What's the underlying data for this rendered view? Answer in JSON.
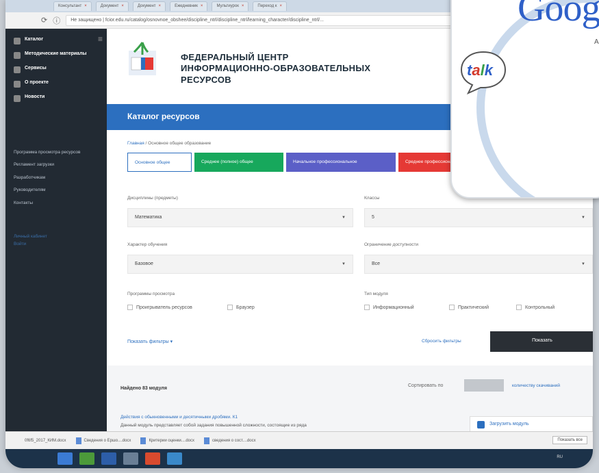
{
  "browser": {
    "tabs": [
      "Консультант",
      "Документ",
      "Документ",
      "Ежедневник",
      "Мультиурок",
      "Переход к"
    ],
    "tab_close": "×",
    "url": "Не защищено | fcior.edu.ru/catalog/osnovnoe_obshee/discipline_ntrl/discipline_ntrl/learning_character/discipline_ntrl/..."
  },
  "sidebar": {
    "items": [
      {
        "label": "Каталог",
        "icon": "catalog-icon"
      },
      {
        "label": "Методические материалы",
        "icon": "book-icon"
      },
      {
        "label": "Сервисы",
        "icon": "gear-icon"
      },
      {
        "label": "О проекте",
        "icon": "info-icon"
      },
      {
        "label": "Новости",
        "icon": "news-icon"
      }
    ],
    "subitems": [
      "Программа просмотра ресурсов",
      "Регламент загрузки",
      "Разработчикам",
      "Руководителям",
      "Контакты"
    ],
    "login": [
      "Личный кабинет",
      "Войти"
    ]
  },
  "header": {
    "org_name_line1": "ФЕДЕРАЛЬНЫЙ ЦЕНТР",
    "org_name_line2": "ИНФОРМАЦИОННО-ОБРАЗОВАТЕЛЬНЫХ",
    "org_name_line3": "РЕСУРСОВ"
  },
  "catalog": {
    "title": "Каталог ресурсов",
    "breadcrumb_home": "Главная",
    "breadcrumb_sep": " / ",
    "breadcrumb_current": "Основное общее образование",
    "levels": [
      {
        "label": "Основное общее",
        "color": "#ffffff",
        "text": "#2c6fbf"
      },
      {
        "label": "Среднее (полное) общее",
        "color": "#17a85c",
        "text": "#ffffff"
      },
      {
        "label": "Начальное профессиональное",
        "color": "#5b5fc7",
        "text": "#ffffff"
      },
      {
        "label": "Среднее профессиональное",
        "color": "#e53935",
        "text": "#ffffff"
      }
    ]
  },
  "filters": {
    "discipline_label": "Дисциплины (предметы)",
    "discipline_value": "Математика",
    "class_label": "Классы",
    "class_value": "5",
    "learning_label": "Характер обучения",
    "learning_value": "Базовое",
    "access_label": "Ограничение доступности",
    "access_value": "Все",
    "viewer_label": "Программы просмотра",
    "viewer_options": [
      "Проигрыватель ресурсов",
      "Браузер"
    ],
    "module_label": "Тип модуля",
    "module_options": [
      "Информационный",
      "Практический",
      "Контрольный"
    ],
    "more_link": "Показать фильтры",
    "reset_link": "Сбросить фильтры",
    "show_button": "Показать"
  },
  "results": {
    "found_text": "Найдено 83 модуля",
    "sort_label": "Сортировать по",
    "sort_option": "количеству скачиваний",
    "item_title": "Действия с обыкновенными и десятичными дробями. К1",
    "item_desc": "Данный модуль представляет собой задания повышенной сложности, состоящие из ряда",
    "download_label": "Загрузить модуль"
  },
  "downloads": {
    "files": [
      "0f6f5_2017_КИМ.docx",
      "Сведения о Ершо....docx",
      "Критерии оценки....docx",
      "сведения о сост....docx"
    ],
    "show_all": "Показать все"
  },
  "taskbar": {
    "tray_text": "RU"
  },
  "overlay": {
    "logo_word": "Google",
    "logo_sub": "A",
    "talk": "talk"
  }
}
